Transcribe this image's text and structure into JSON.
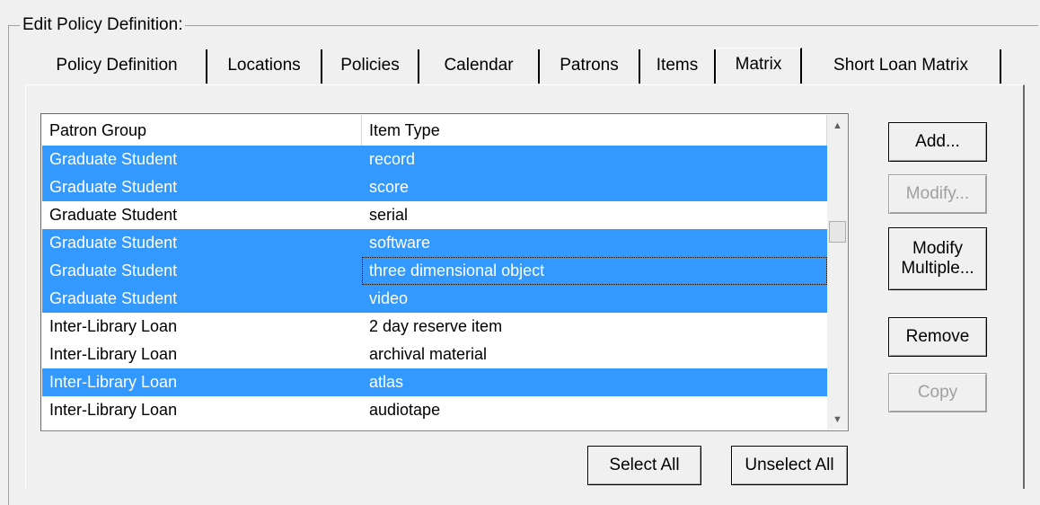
{
  "group_title": "Edit  Policy Definition:",
  "tabs": [
    {
      "label": "Policy Definition"
    },
    {
      "label": "Locations"
    },
    {
      "label": "Policies"
    },
    {
      "label": "Calendar"
    },
    {
      "label": "Patrons"
    },
    {
      "label": "Items"
    },
    {
      "label": "Matrix"
    },
    {
      "label": "Short Loan Matrix"
    }
  ],
  "list": {
    "columns": [
      "Patron Group",
      "Item Type"
    ],
    "rows": [
      {
        "patron_group": "Graduate Student",
        "item_type": "record",
        "selected": true
      },
      {
        "patron_group": "Graduate Student",
        "item_type": "score",
        "selected": true
      },
      {
        "patron_group": "Graduate Student",
        "item_type": "serial",
        "selected": false
      },
      {
        "patron_group": "Graduate Student",
        "item_type": "software",
        "selected": true
      },
      {
        "patron_group": "Graduate Student",
        "item_type": "three dimensional object",
        "selected": true,
        "focused": true
      },
      {
        "patron_group": "Graduate Student",
        "item_type": "video",
        "selected": true
      },
      {
        "patron_group": "Inter-Library Loan",
        "item_type": "2 day reserve item",
        "selected": false
      },
      {
        "patron_group": "Inter-Library Loan",
        "item_type": "archival material",
        "selected": false
      },
      {
        "patron_group": "Inter-Library Loan",
        "item_type": "atlas",
        "selected": true
      },
      {
        "patron_group": "Inter-Library Loan",
        "item_type": "audiotape",
        "selected": false
      }
    ]
  },
  "buttons": {
    "add": "Add...",
    "modify": "Modify...",
    "modify_multiple_1": "Modify",
    "modify_multiple_2": "Multiple...",
    "remove": "Remove",
    "copy": "Copy",
    "select_all": "Select All",
    "unselect_all": "Unselect All"
  }
}
